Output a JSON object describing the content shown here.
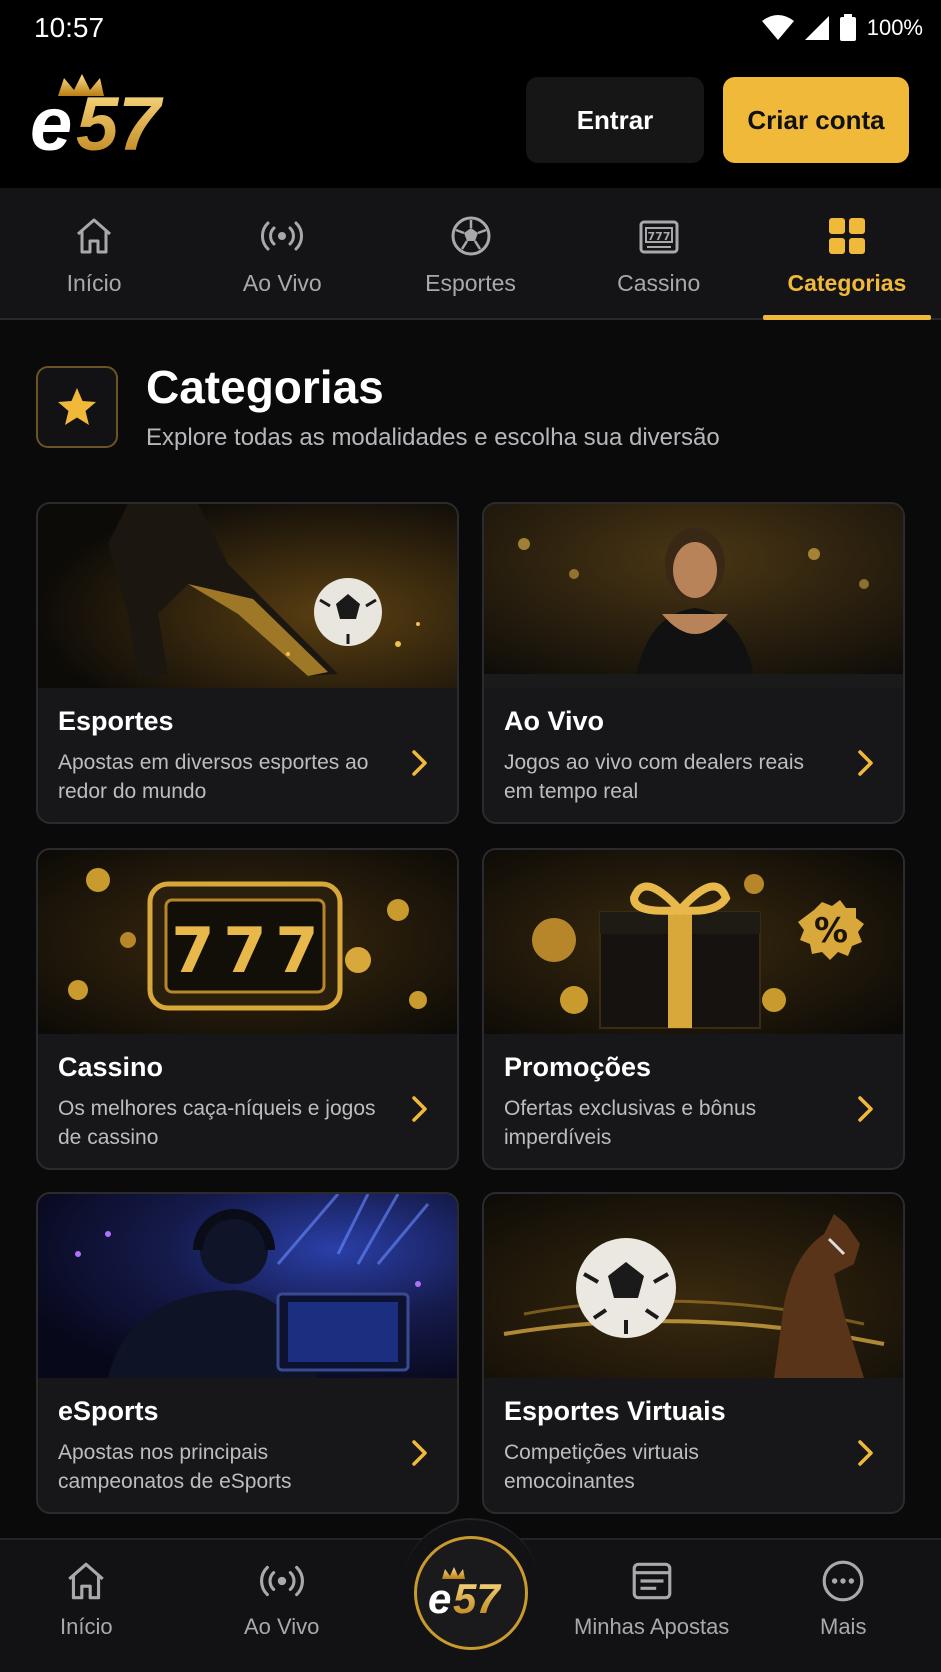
{
  "status": {
    "time": "10:57",
    "battery": "100%"
  },
  "header": {
    "logo_text": "e57",
    "login_label": "Entrar",
    "signup_label": "Criar conta"
  },
  "topnav": [
    {
      "label": "Início",
      "icon": "home-icon"
    },
    {
      "label": "Ao Vivo",
      "icon": "live-icon"
    },
    {
      "label": "Esportes",
      "icon": "soccer-ball-icon"
    },
    {
      "label": "Cassino",
      "icon": "slot-machine-icon"
    },
    {
      "label": "Categorias",
      "icon": "grid-icon",
      "active": true
    }
  ],
  "page": {
    "title": "Categorias",
    "subtitle": "Explore todas as modalidades e escolha sua diversão"
  },
  "cards": [
    {
      "title": "Esportes",
      "desc": "Apostas em diversos esportes ao redor do mundo"
    },
    {
      "title": "Ao Vivo",
      "desc": "Jogos ao vivo com dealers reais em tempo real"
    },
    {
      "title": "Cassino",
      "desc": "Os melhores caça-níqueis e jogos de cassino"
    },
    {
      "title": "Promoções",
      "desc": "Ofertas exclusivas e bônus imperdíveis"
    },
    {
      "title": "eSports",
      "desc": "Apostas nos principais campeonatos de eSports"
    },
    {
      "title": "Esportes Virtuais",
      "desc": "Competições virtuais emocoinantes"
    }
  ],
  "bottomnav": [
    {
      "label": "Início",
      "icon": "home-icon"
    },
    {
      "label": "Ao Vivo",
      "icon": "live-icon"
    },
    {
      "label": "Minhas Apostas",
      "icon": "ticket-icon"
    },
    {
      "label": "Mais",
      "icon": "more-icon"
    }
  ],
  "colors": {
    "accent": "#f0b93a",
    "background": "#0a0a0b",
    "card": "#17171a"
  }
}
